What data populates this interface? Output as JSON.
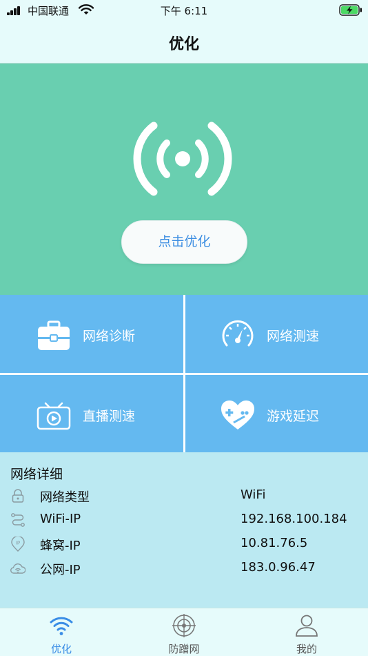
{
  "status_bar": {
    "carrier": "中国联通",
    "time": "下午 6:11"
  },
  "header": {
    "title": "优化"
  },
  "hero": {
    "icon": "signal-broadcast-icon",
    "optimize_button": "点击优化"
  },
  "tools": [
    {
      "label": "网络诊断",
      "icon": "toolbox-icon"
    },
    {
      "label": "网络测速",
      "icon": "speedometer-icon"
    },
    {
      "label": "直播测速",
      "icon": "tv-play-icon"
    },
    {
      "label": "游戏延迟",
      "icon": "gamepad-heart-icon"
    }
  ],
  "details": {
    "title": "网络详细",
    "rows": [
      {
        "label": "网络类型",
        "value": "WiFi",
        "icon": "lock-icon"
      },
      {
        "label": "WiFi-IP",
        "value": "192.168.100.184",
        "icon": "route-icon"
      },
      {
        "label": "蜂窝-IP",
        "value": "10.81.76.5",
        "icon": "ip-pin-icon"
      },
      {
        "label": "公网-IP",
        "value": "183.0.96.47",
        "icon": "cloud-wifi-icon"
      }
    ]
  },
  "tabbar": {
    "tabs": [
      {
        "label": "优化",
        "icon": "wifi-icon",
        "active": true
      },
      {
        "label": "防蹭网",
        "icon": "radar-icon",
        "active": false
      },
      {
        "label": "我的",
        "icon": "user-icon",
        "active": false
      }
    ]
  },
  "colors": {
    "hero_bg": "#69cfb0",
    "tile_bg": "#64b9f0",
    "details_bg": "#bbe9f2",
    "accent": "#3a8de6",
    "page_bg": "#e6fbfb"
  }
}
